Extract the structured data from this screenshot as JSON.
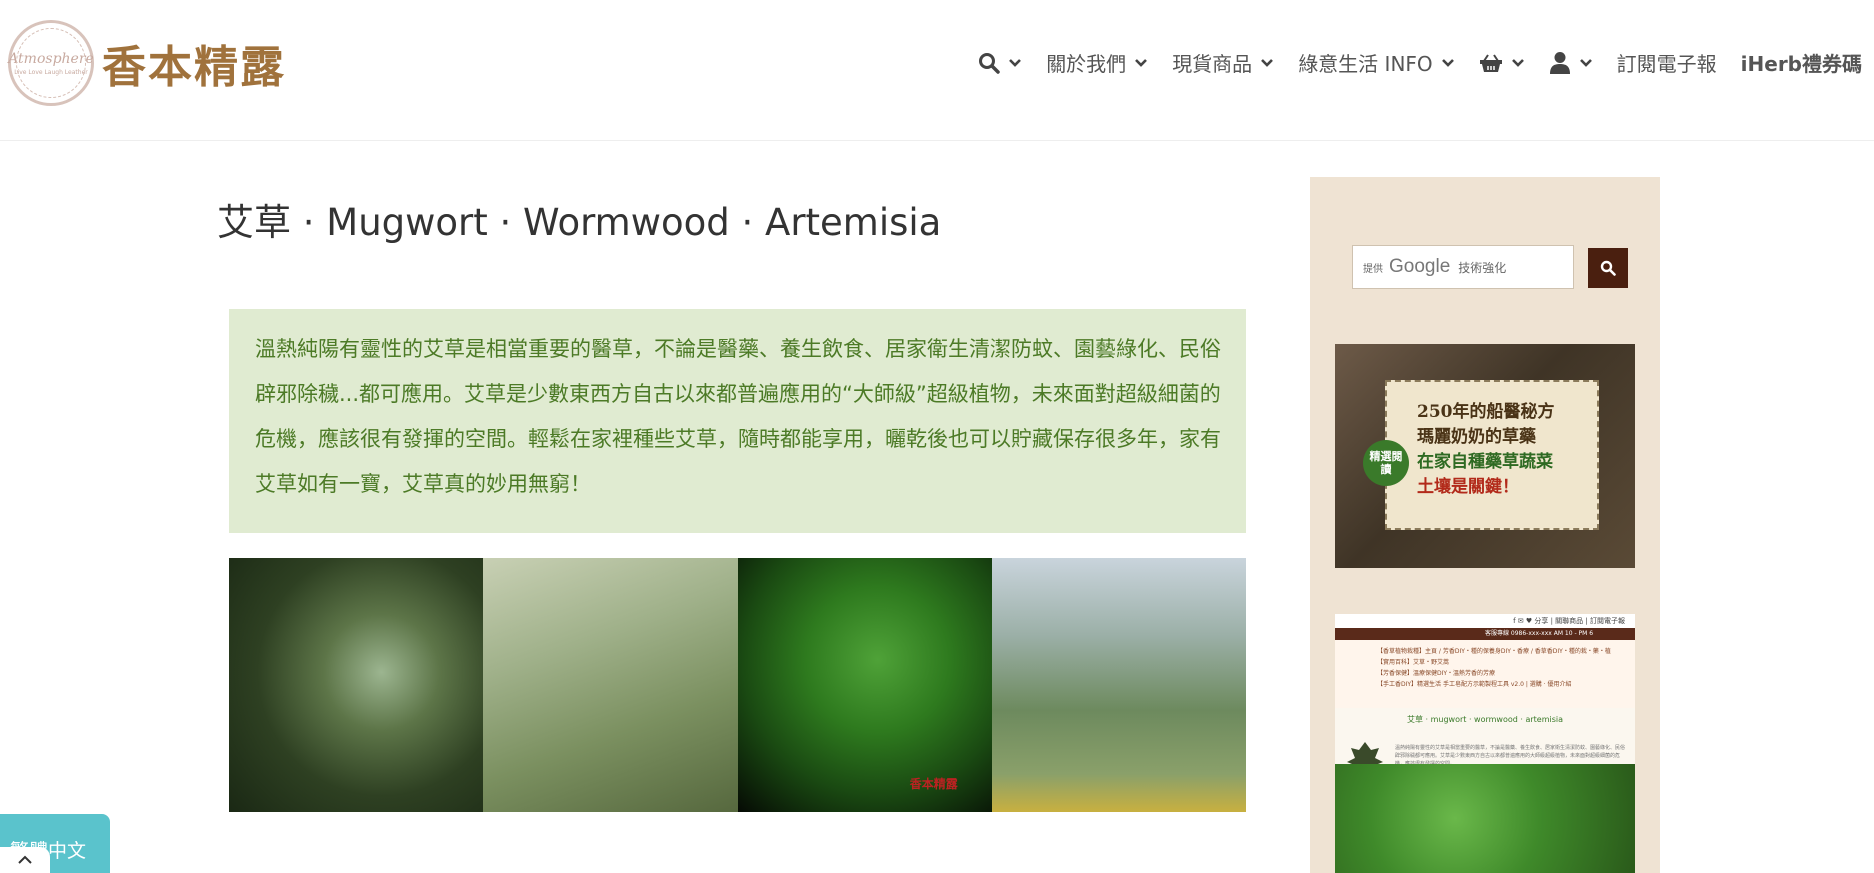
{
  "header": {
    "logo": {
      "seal_text": "Atmosphere",
      "seal_subtext": "Live Love Laugh Leather",
      "title": "香本精露"
    },
    "nav": [
      {
        "id": "search",
        "icon": "search-icon"
      },
      {
        "id": "about",
        "label": "關於我們"
      },
      {
        "id": "products",
        "label": "現貨商品"
      },
      {
        "id": "green-life",
        "label": "綠意生活 INFO"
      },
      {
        "id": "cart",
        "icon": "basket-icon"
      },
      {
        "id": "account",
        "icon": "user-icon"
      },
      {
        "id": "newsletter",
        "label": "訂閱電子報"
      },
      {
        "id": "iherb",
        "label": "iHerb禮券碼"
      }
    ]
  },
  "main": {
    "title": "艾草 · Mugwort · Wormwood · Artemisia",
    "intro": "溫熱純陽有靈性的艾草是相當重要的醫草，不論是醫藥、養生飲食、居家衛生清潔防蚊、園藝綠化、民俗辟邪除穢...都可應用。艾草是少數東西方自古以來都普遍應用的“大師級”超級植物，未來面對超級細菌的危機，應該很有發揮的空間。輕鬆在家裡種些艾草，隨時都能享用，曬乾後也可以貯藏保存很多年，家有艾草如有一寶，艾草真的妙用無窮！",
    "photo_watermark": "香本精露"
  },
  "sidebar": {
    "search": {
      "powered_by": "提供",
      "google": "Google",
      "enhanced": "技術強化"
    },
    "ad1": {
      "badge": "精選閱讀",
      "lines": [
        "250年的船醫秘方",
        "瑪麗奶奶的草藥",
        "在家自種藥草蔬菜",
        "土壤是關鍵！"
      ]
    },
    "ad2": {
      "topbar": "f ✉ ♥  分享 | 關聯商品 | 訂閱電子報",
      "bar": "客服專線 0986-xxx-xxx  AM 10 - PM 6",
      "menu": [
        "【香草植物栽種】主頁 / 芳香DIY・種的保養身DIY・香療 / 香草香DIY・種的栽・藥・植",
        "【實用百科】艾草・野艾蒿",
        "【芳香保健】溫療保健DIY・溫熱芳香的芳療",
        "【手工香DIY】精選生活 手工皂配方示範製程工具 v2.0 | 選購 · 優用介紹"
      ],
      "heading": "艾草 · mugwort · wormwood · artemisia",
      "text": "溫熱純陽有靈性的艾草是相當重要的醫草，不論是醫藥、養生飲食、居家衛生清潔防蚊、園藝綠化、民俗辟邪除穢都可應用。艾草是少數東西方自古以來都普遍應用的大師級超級植物，未來面對超級細菌的危機，應該很有發揮的空間。"
    }
  },
  "lang_bar": {
    "label": "繁體中文"
  }
}
